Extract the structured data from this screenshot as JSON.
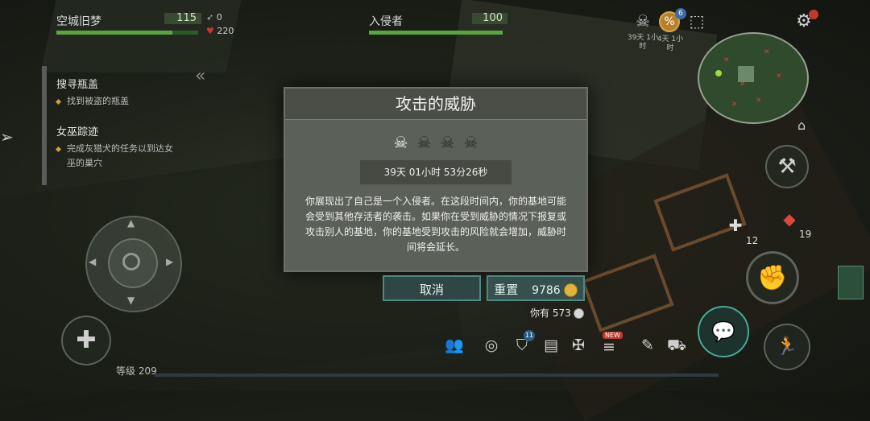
{
  "player": {
    "name": "空城旧梦",
    "hp": "115",
    "hp_fraction": 0.82,
    "kills": "0",
    "blood": "220"
  },
  "enemy": {
    "name": "入侵者",
    "hp": "100",
    "hp_fraction": 1.0
  },
  "quests": [
    {
      "title": "搜寻瓶盖",
      "desc": "找到被盗的瓶盖"
    },
    {
      "title": "女巫踪迹",
      "desc_line1": "完成灰猎犬的任务以到达女",
      "desc_line2": "巫的巢穴"
    }
  ],
  "timers": {
    "skull_label_1": "39天 1小",
    "skull_label_2": "时",
    "gift_label_1": "4天 1小",
    "gift_label_2": "时",
    "gift_badge": "6"
  },
  "dialog": {
    "title": "攻击的威胁",
    "threat_level": 1,
    "threat_max": 4,
    "countdown": "39天 01小时 53分26秒",
    "text": "你展现出了自己是一个入侵者。在这段时间内，你的基地可能会受到其他存活者的袭击。如果你在受到威胁的情况下报复或攻击别人的基地，你的基地受到攻击的风险就会增加，威胁时间将会延长。",
    "cancel_label": "取消",
    "reset_label": "重置",
    "reset_cost": "9786",
    "owned_label": "你有",
    "owned_amount": "573"
  },
  "hud": {
    "level_label": "等级 209",
    "left_num": "12",
    "right_num": "19",
    "badge_11": "11",
    "badge_new": "NEW"
  },
  "colors": {
    "accent": "#4e8a83",
    "health": "#57a83c",
    "gold": "#e2b33a"
  }
}
